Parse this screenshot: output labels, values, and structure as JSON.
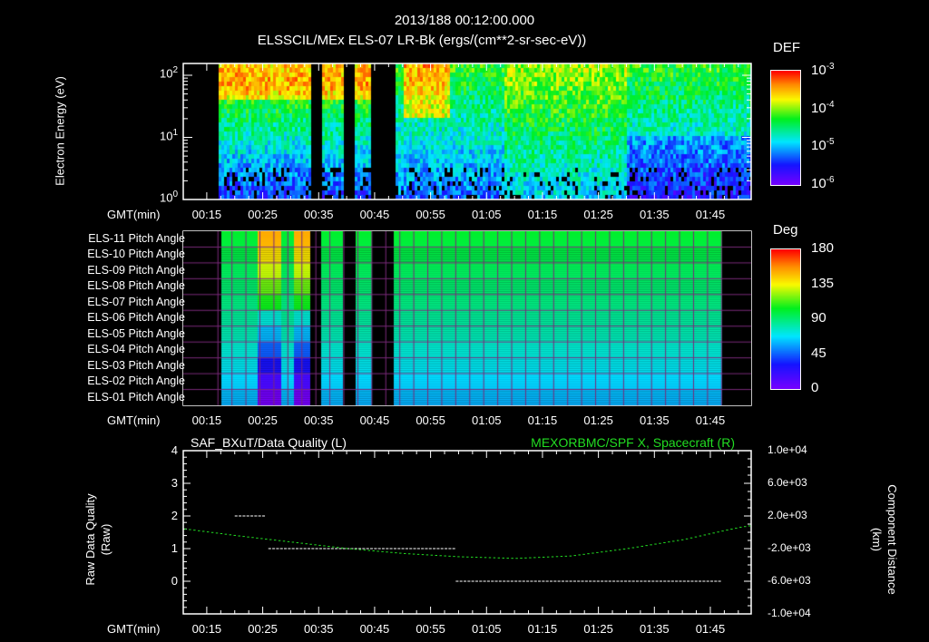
{
  "header": {
    "timestamp": "2013/188 00:12:00.000",
    "title": "ELSSCIL/MEx ELS-07 LR-Bk  (ergs/(cm**2-sr-sec-eV))"
  },
  "colors": {
    "background": "#000000",
    "axis": "#ffffff",
    "spacecraft_line": "#22dd22"
  },
  "chart_data": [
    {
      "type": "heatmap",
      "name": "energy-spectrogram",
      "ylabel": "Electron Energy (eV)",
      "yscale": "log",
      "ylim": [
        1,
        160
      ],
      "yticks": [
        "10",
        "10",
        "10"
      ],
      "ytick_exponents": [
        "2",
        "1",
        "0"
      ],
      "xlabel": "GMT(min)",
      "xticks": [
        "00:15",
        "00:25",
        "00:35",
        "00:45",
        "00:55",
        "01:05",
        "01:15",
        "01:25",
        "01:35",
        "01:45"
      ],
      "data_gaps_min": [
        [
          0,
          6
        ],
        [
          22.5,
          24.5
        ],
        [
          28.5,
          30.5
        ],
        [
          33.5,
          37.5
        ]
      ],
      "colorbar": {
        "label": "DEF",
        "ticks": [
          "10",
          "10",
          "10",
          "10"
        ],
        "exponents": [
          "-3",
          "-4",
          "-5",
          "-6"
        ],
        "range": [
          1e-06,
          0.001
        ]
      }
    },
    {
      "type": "heatmap",
      "name": "pitch-angle",
      "rows": [
        "ELS-11 Pitch Angle",
        "ELS-10 Pitch Angle",
        "ELS-09 Pitch Angle",
        "ELS-08 Pitch Angle",
        "ELS-07 Pitch Angle",
        "ELS-06 Pitch Angle",
        "ELS-05 Pitch Angle",
        "ELS-04 Pitch Angle",
        "ELS-03 Pitch Angle",
        "ELS-02 Pitch Angle",
        "ELS-01 Pitch Angle"
      ],
      "row_values_deg": [
        102,
        99,
        96,
        93,
        90,
        86,
        82,
        77,
        72,
        67,
        62
      ],
      "xlabel": "GMT(min)",
      "xticks": [
        "00:15",
        "00:25",
        "00:35",
        "00:45",
        "00:55",
        "01:05",
        "01:15",
        "01:25",
        "01:35",
        "01:45"
      ],
      "colorbar": {
        "label": "Deg",
        "ticks": [
          "180",
          "135",
          "90",
          "45",
          "0"
        ],
        "range": [
          0,
          180
        ]
      }
    },
    {
      "type": "line",
      "name": "quality-and-position",
      "left_title": "SAF_BXuT/Data Quality (L)",
      "right_title": "MEXORBMC/SPF X, Spacecraft (R)",
      "left_ylabel": "Raw Data Quality",
      "left_ylabel2": "(Raw)",
      "right_ylabel": "Component Distance",
      "right_ylabel2": "(km)",
      "left_ticks": [
        "4",
        "3",
        "2",
        "1",
        "0"
      ],
      "left_ylim": [
        -1,
        4
      ],
      "right_ticks": [
        "1.0e+04",
        "6.0e+03",
        "2.0e+03",
        "-2.0e+03",
        "-6.0e+03",
        "-1.0e+04"
      ],
      "right_ylim": [
        -10000,
        10000
      ],
      "xlabel": "GMT(min)",
      "xticks": [
        "00:15",
        "00:25",
        "00:35",
        "00:45",
        "00:55",
        "01:05",
        "01:15",
        "01:25",
        "01:35",
        "01:45"
      ],
      "quality_segments": [
        {
          "start_min": 20,
          "end_min": 25,
          "value": 2
        },
        {
          "start_min": 26,
          "end_min": 59,
          "value": 1
        },
        {
          "start_min": 59.5,
          "end_min": 107,
          "value": 0
        }
      ],
      "spacecraft_x_km": {
        "x_min": [
          11,
          20,
          30,
          40,
          50,
          60,
          70,
          80,
          90,
          100,
          110,
          112
        ],
        "y": [
          400,
          -400,
          -1200,
          -2000,
          -2600,
          -3000,
          -3200,
          -2900,
          -2000,
          -900,
          600,
          800
        ]
      }
    }
  ]
}
